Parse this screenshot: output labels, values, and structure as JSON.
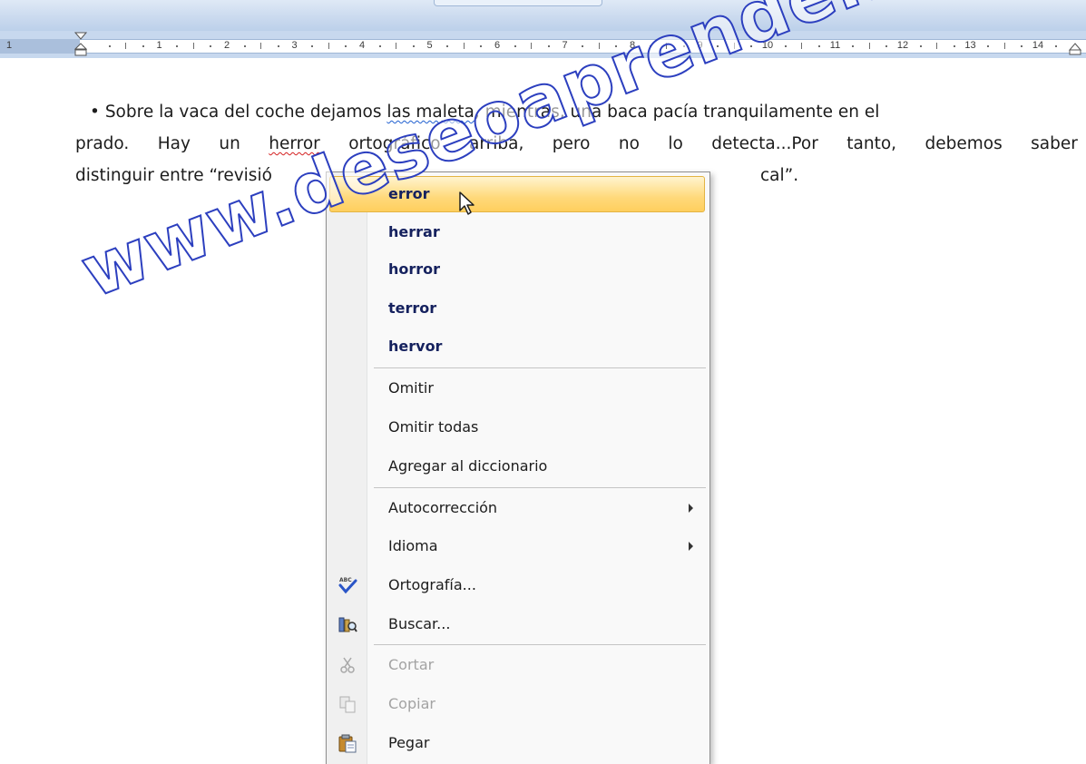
{
  "ruler": {
    "numbers": [
      "1",
      "1",
      "2",
      "3",
      "4",
      "5",
      "6",
      "7",
      "8",
      "9",
      "10",
      "11",
      "12",
      "13",
      "14"
    ]
  },
  "document": {
    "line1": {
      "bullet": "•",
      "t1": "Sobre la vaca del coche dejamos ",
      "sq1": "las maleta",
      "t2": ", mientras, una baca pacía tranquilamente en el"
    },
    "line2": {
      "words_before": [
        "prado.",
        "Hay",
        "un"
      ],
      "misspelled": "herror",
      "words_after": [
        "ortográfico",
        "arriba,",
        "pero",
        "no",
        "lo",
        "detecta...Por",
        "tanto,",
        "debemos",
        "saber"
      ]
    },
    "line3": {
      "start": "distinguir entre “revisió",
      "end": "cal”."
    }
  },
  "watermark": "www.deseoaprender.com",
  "context_menu": {
    "suggestions": [
      "error",
      "herrar",
      "horror",
      "terror",
      "hervor"
    ],
    "group2": [
      "Omitir",
      "Omitir todas",
      "Agregar al diccionario"
    ],
    "group3": [
      "Autocorrección",
      "Idioma",
      "Ortografía...",
      "Buscar..."
    ],
    "group4": [
      "Cortar",
      "Copiar",
      "Pegar"
    ]
  },
  "colors": {
    "highlight": "#ffd97a",
    "suggestion_text": "#15215e",
    "watermark_outline": "#2c3fbf"
  }
}
